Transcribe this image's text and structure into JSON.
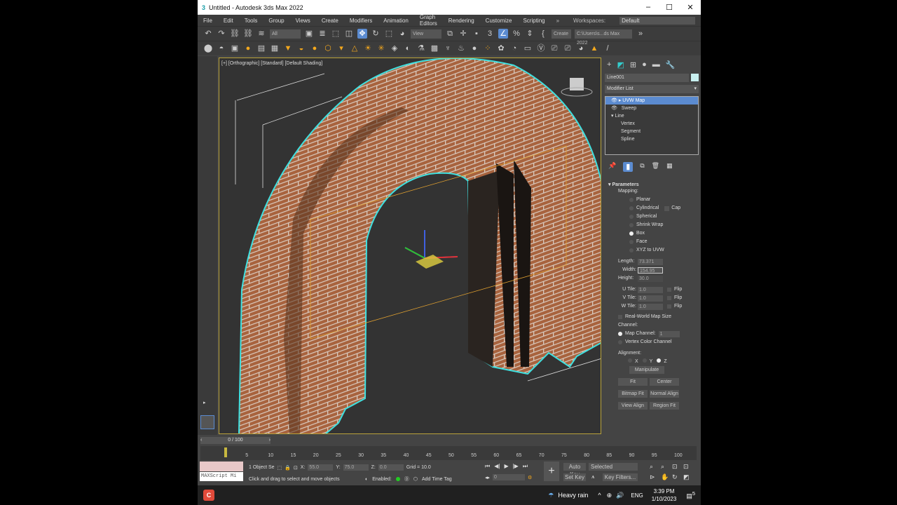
{
  "title": "Untitled - Autodesk 3ds Max 2022",
  "menu": [
    "File",
    "Edit",
    "Tools",
    "Group",
    "Views",
    "Create",
    "Modifiers",
    "Animation",
    "Graph Editors",
    "Rendering",
    "Customize",
    "Scripting"
  ],
  "workspaces_label": "Workspaces:",
  "workspace": "Default",
  "toolbar": {
    "filter": "All",
    "ref_coord": "View",
    "create_sel": "Create",
    "path": "C:\\Users\\s...ds Max 2022"
  },
  "viewport_label": "[+] [Orthographic] [Standard] [Default Shading]",
  "panel": {
    "object_name": "Line001",
    "modifier_list": "Modifier List",
    "stack": [
      "UVW Map",
      "Sweep",
      "Line",
      "Vertex",
      "Segment",
      "Spline"
    ],
    "rollout": "Parameters",
    "mapping_label": "Mapping:",
    "mapping": [
      "Planar",
      "Cylindrical",
      "Spherical",
      "Shrink Wrap",
      "Box",
      "Face",
      "XYZ to UVW"
    ],
    "cap": "Cap",
    "length_label": "Length:",
    "length": "73.371",
    "width_label": "Width:",
    "width": "154.95",
    "height_label": "Height:",
    "height": "30.0",
    "utile_label": "U Tile:",
    "utile": "1.0",
    "vtile_label": "V Tile:",
    "vtile": "1.0",
    "wtile_label": "W Tile:",
    "wtile": "1.0",
    "flip": "Flip",
    "realworld": "Real-World Map Size",
    "channel_label": "Channel:",
    "map_channel": "Map Channel:",
    "map_channel_val": "1",
    "vertex_color": "Vertex Color Channel",
    "alignment_label": "Alignment:",
    "x": "X",
    "y": "Y",
    "z": "Z",
    "manipulate": "Manipulate",
    "fit": "Fit",
    "center": "Center",
    "bitmap_fit": "Bitmap Fit",
    "normal_align": "Normal Align",
    "view_align": "View Align",
    "region_fit": "Region Fit"
  },
  "timeline": {
    "frame": "0 / 100",
    "ticks": [
      "5",
      "10",
      "15",
      "20",
      "25",
      "30",
      "35",
      "40",
      "45",
      "50",
      "55",
      "60",
      "65",
      "70",
      "75",
      "80",
      "85",
      "90",
      "95",
      "100"
    ]
  },
  "status": {
    "selection": "1 Object Se",
    "x_label": "X:",
    "x": "55.0",
    "y_label": "Y:",
    "y": "75.0",
    "z_label": "Z:",
    "z": "0.0",
    "grid": "Grid = 10.0",
    "prompt": "Click and drag to select and move objects",
    "enabled": "Enabled:",
    "add_time_tag": "Add Time Tag",
    "maxscript": "MAXScript Mi",
    "frame_field": "0",
    "auto_key": "Auto Key",
    "set_key": "Set Key",
    "selected": "Selected",
    "key_filters": "Key Filters..."
  },
  "taskbar": {
    "weather": "Heavy rain",
    "lang": "ENG",
    "time": "3:39 PM",
    "date": "1/10/2023",
    "notif": "5"
  }
}
